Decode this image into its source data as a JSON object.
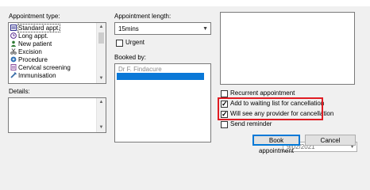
{
  "labels": {
    "appointment_type": "Appointment type:",
    "appointment_length": "Appointment length:",
    "booked_by": "Booked by:",
    "details": "Details:"
  },
  "appointment_types": [
    {
      "label": "Standard appt.",
      "icon": "standard-appointment-icon",
      "selected": true
    },
    {
      "label": "Long appt.",
      "icon": "clock-icon",
      "selected": false
    },
    {
      "label": "New patient",
      "icon": "person-icon",
      "selected": false
    },
    {
      "label": "Excision",
      "icon": "scissors-icon",
      "selected": false
    },
    {
      "label": "Procedure",
      "icon": "procedure-icon",
      "selected": false
    },
    {
      "label": "Cervical screening",
      "icon": "screening-icon",
      "selected": false
    },
    {
      "label": "Immunisation",
      "icon": "syringe-icon",
      "selected": false
    }
  ],
  "appointment_length": {
    "value": "15mins"
  },
  "urgent": {
    "label": "Urgent",
    "checked": false
  },
  "booked_by_list": [
    {
      "label": "Dr F. Findacure",
      "highlighted": false
    }
  ],
  "options": {
    "recurrent": {
      "label": "Recurrent appointment",
      "checked": false
    },
    "waiting_list": {
      "label": "Add to waiting list for cancellation",
      "checked": true
    },
    "any_provider": {
      "label": "Will see any provider for cancellation",
      "checked": true
    },
    "send_reminder": {
      "label": "Send reminder",
      "checked": false
    }
  },
  "reminder_date": "9/02/2021",
  "buttons": {
    "book": "Book appointment",
    "cancel": "Cancel"
  },
  "colors": {
    "highlight": "#0a78d7",
    "annotation_red": "#e01b22",
    "default_button_border": "#0078d7"
  }
}
